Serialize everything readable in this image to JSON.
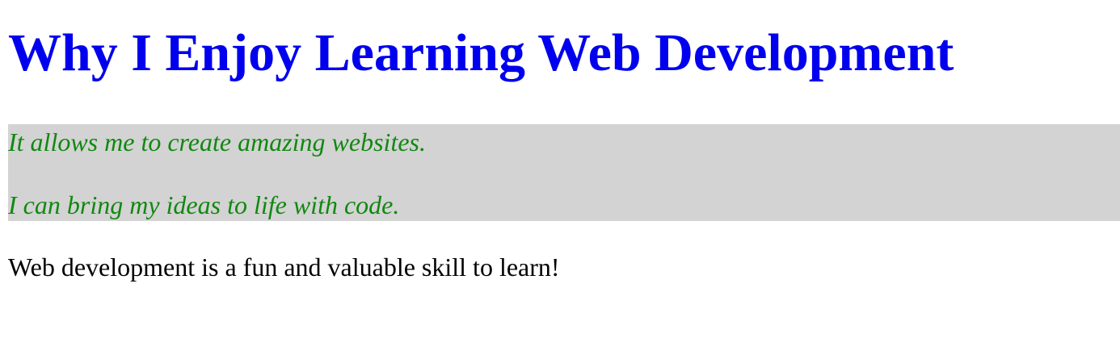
{
  "heading": {
    "text": "Why I Enjoy Learning Web Development",
    "color": "#0000ee"
  },
  "highlight": {
    "background": "#d3d3d3",
    "text_color": "#118811",
    "lines": [
      "It allows me to create amazing websites.",
      "I can bring my ideas to life with code."
    ]
  },
  "body": {
    "text": "Web development is a fun and valuable skill to learn!",
    "color": "#000000"
  }
}
